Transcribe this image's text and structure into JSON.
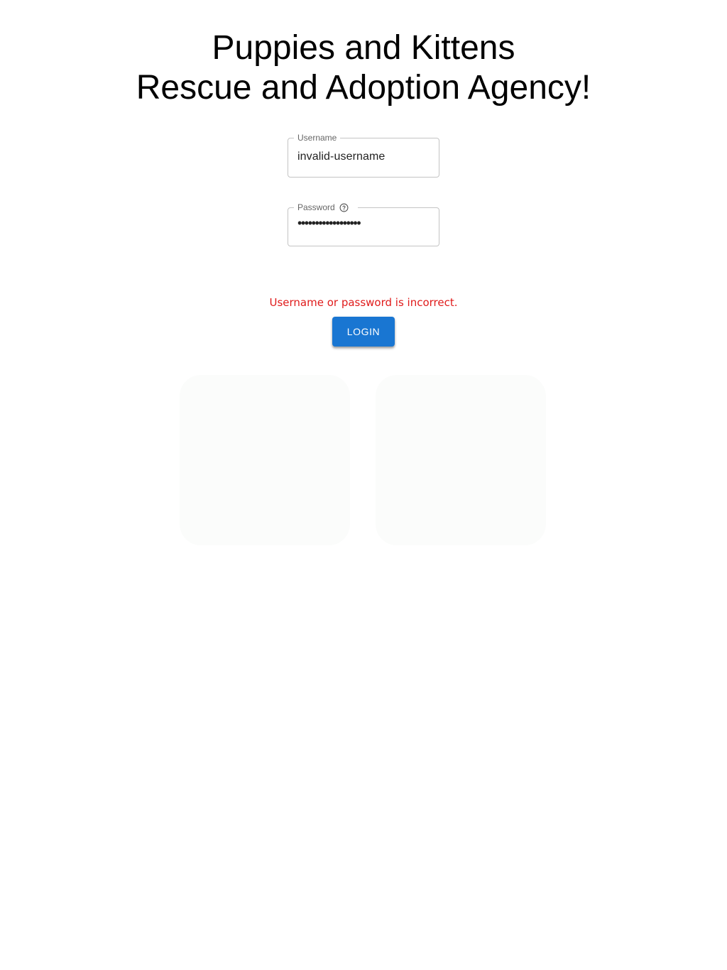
{
  "header": {
    "title_line1": "Puppies and Kittens",
    "title_line2": "Rescue and Adoption Agency!"
  },
  "form": {
    "username": {
      "label": "Username",
      "value": "invalid-username"
    },
    "password": {
      "label": "Password",
      "value": "••••••••••••••••••",
      "help_icon": "question-circle-icon"
    },
    "error_message": "Username or password is incorrect.",
    "login_label": "LOGIN"
  },
  "images": {
    "dog": "puppy-illustration",
    "cat": "kitten-illustration"
  },
  "colors": {
    "primary": "#1976d2",
    "error": "#e01b1b"
  }
}
